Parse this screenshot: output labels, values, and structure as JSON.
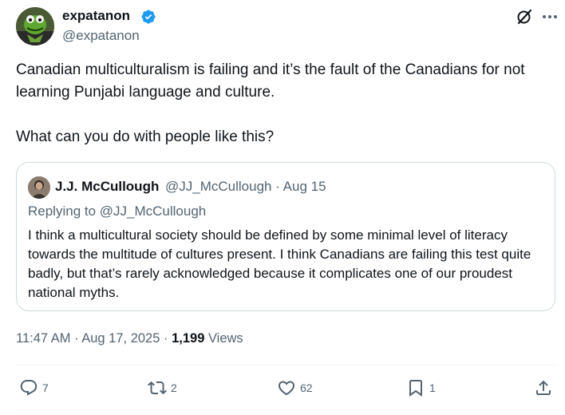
{
  "author": {
    "display_name": "expatanon",
    "handle": "@expatanon"
  },
  "tweet": {
    "paragraph_1": "Canadian multiculturalism is failing and it’s the fault of the Canadians for not learning Punjabi language and culture.",
    "paragraph_2": "What can you do with people like this?"
  },
  "quote": {
    "display_name": "J.J. McCullough",
    "handle_and_date": "@JJ_McCullough · Aug 15",
    "replying_to": "Replying to @JJ_McCullough",
    "text": "I think a multicultural society should be defined by some minimal level of literacy towards the multitude of cultures present. I think Canadians are failing this test quite badly, but that’s rarely acknowledged because it complicates one of our proudest national myths."
  },
  "meta": {
    "timestamp": "11:47 AM · Aug 17, 2025 · ",
    "views_count": "1,199",
    "views_label": " Views"
  },
  "actions": {
    "replies": "7",
    "reposts": "2",
    "likes": "62",
    "bookmarks": "1"
  },
  "colors": {
    "verified": "#1d9bf0",
    "secondary_text": "#536471",
    "primary_text": "#0f1419",
    "border": "#cfd9de"
  }
}
